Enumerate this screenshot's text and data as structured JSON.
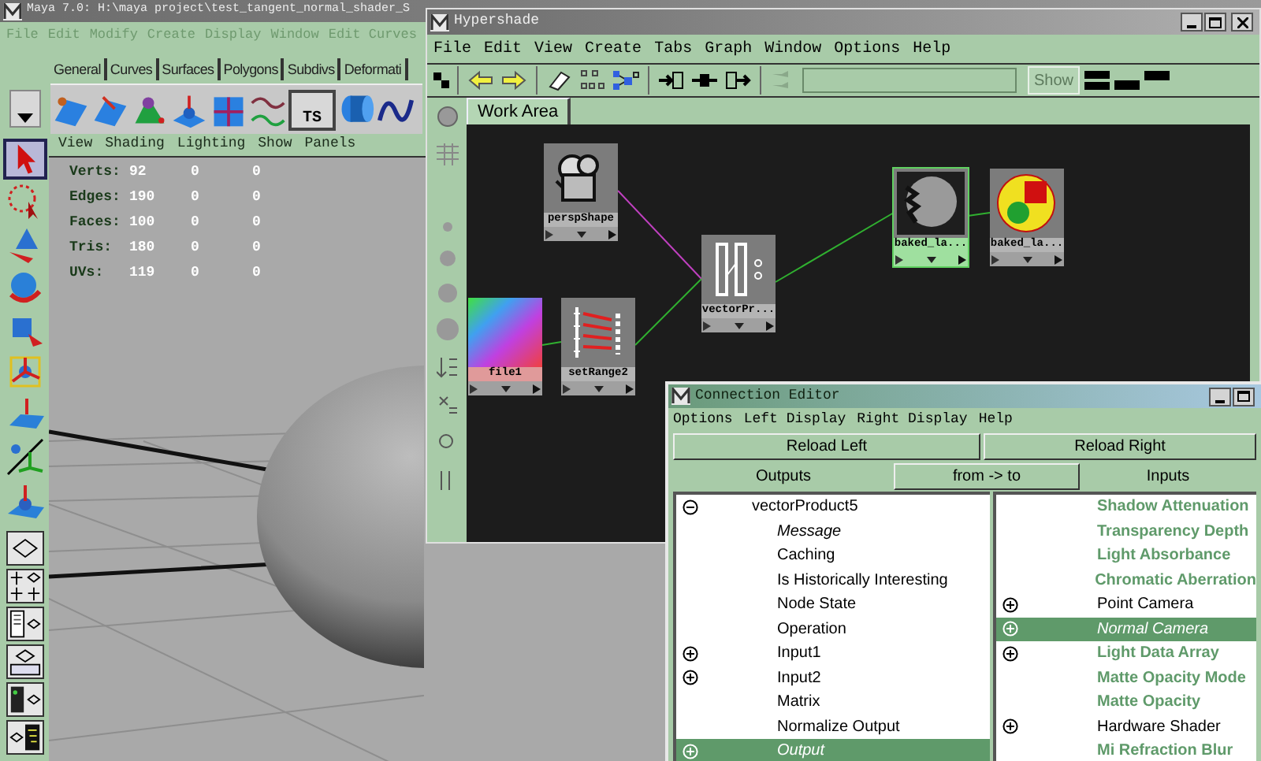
{
  "maya": {
    "title": "Maya 7.0: H:\\maya project\\test_tangent_normal_shader_S",
    "menu": [
      "File",
      "Edit",
      "Modify",
      "Create",
      "Display",
      "Window",
      "Edit Curves"
    ],
    "shelf_tabs": [
      "General",
      "Curves",
      "Surfaces",
      "Polygons",
      "Subdivs",
      "Deformati"
    ],
    "shelf_icon_label": "TS",
    "toolbox": [
      {
        "kind": "select",
        "selected": true
      },
      {
        "kind": "lasso",
        "selected": false
      },
      {
        "kind": "move",
        "selected": false
      },
      {
        "kind": "rotate",
        "selected": false
      },
      {
        "kind": "scale",
        "selected": false
      },
      {
        "kind": "manipulator",
        "selected": false
      },
      {
        "kind": "soft",
        "selected": false
      },
      {
        "kind": "axes",
        "selected": false
      },
      {
        "kind": "last",
        "selected": false
      }
    ],
    "panel_menu": [
      "View",
      "Shading",
      "Lighting",
      "Show",
      "Panels"
    ],
    "stats": [
      {
        "label": "Verts:",
        "values": [
          "92",
          "0",
          "0"
        ]
      },
      {
        "label": "Edges:",
        "values": [
          "190",
          "0",
          "0"
        ]
      },
      {
        "label": "Faces:",
        "values": [
          "100",
          "0",
          "0"
        ]
      },
      {
        "label": "Tris:",
        "values": [
          "180",
          "0",
          "0"
        ]
      },
      {
        "label": "UVs:",
        "values": [
          "119",
          "0",
          "0"
        ]
      }
    ]
  },
  "hypershade": {
    "title": "Hypershade",
    "menu": [
      "File",
      "Edit",
      "View",
      "Create",
      "Tabs",
      "Graph",
      "Window",
      "Options",
      "Help"
    ],
    "show_button": {
      "label": "Show",
      "disabled": true
    },
    "tabs": [
      {
        "label": "Work Area",
        "selected": true
      }
    ],
    "nodes": [
      {
        "label": "perspShape",
        "kind": "camera",
        "selected": false
      },
      {
        "label": "file1",
        "kind": "texture",
        "selected": false
      },
      {
        "label": "setRange2",
        "kind": "range",
        "selected": false
      },
      {
        "label": "vectorPr...",
        "kind": "vector",
        "selected": false
      },
      {
        "label": "baked_la...",
        "kind": "material",
        "selected": true
      },
      {
        "label": "baked_la...",
        "kind": "group",
        "selected": false
      }
    ]
  },
  "connection_editor": {
    "title": "Connection Editor",
    "menu": [
      "Options",
      "Left Display",
      "Right Display",
      "Help"
    ],
    "buttons": [
      "Reload Left",
      "Reload Right"
    ],
    "headers": {
      "left": "Outputs",
      "middle": "from -> to",
      "right": "Inputs"
    },
    "left_list": [
      {
        "label": "vectorProduct5",
        "kind": "compound",
        "expanded": true,
        "selected": false,
        "connected": false,
        "children": [
          {
            "label": "Message",
            "kind": "leaf",
            "selected": false,
            "connected": true
          },
          {
            "label": "Caching",
            "kind": "leaf",
            "selected": false,
            "connected": false
          },
          {
            "label": "Is Historically Interesting",
            "kind": "leaf",
            "selected": false,
            "connected": false
          },
          {
            "label": "Node State",
            "kind": "leaf",
            "selected": false,
            "connected": false
          },
          {
            "label": "Operation",
            "kind": "leaf",
            "selected": false,
            "connected": false
          },
          {
            "label": "Input1",
            "kind": "compound",
            "expanded": false,
            "selected": false,
            "connected": false
          },
          {
            "label": "Input2",
            "kind": "compound",
            "expanded": false,
            "selected": false,
            "connected": false
          },
          {
            "label": "Matrix",
            "kind": "leaf",
            "selected": false,
            "connected": false
          },
          {
            "label": "Normalize Output",
            "kind": "leaf",
            "selected": false,
            "connected": false
          },
          {
            "label": "Output",
            "kind": "compound",
            "expanded": false,
            "selected": true,
            "connected": true
          }
        ]
      }
    ],
    "right_list": [
      {
        "label": "Shadow Attenuation",
        "kind": "leaf",
        "selected": false,
        "connected": false,
        "disabled": true
      },
      {
        "label": "Transparency Depth",
        "kind": "leaf",
        "selected": false,
        "connected": false,
        "disabled": true
      },
      {
        "label": "Light Absorbance",
        "kind": "leaf",
        "selected": false,
        "connected": false,
        "disabled": true
      },
      {
        "label": "Chromatic Aberration",
        "kind": "leaf",
        "selected": false,
        "connected": false,
        "disabled": true
      },
      {
        "label": "Point Camera",
        "kind": "compound",
        "expanded": false,
        "selected": false,
        "connected": false,
        "disabled": false
      },
      {
        "label": "Normal Camera",
        "kind": "compound",
        "expanded": false,
        "selected": true,
        "connected": true,
        "disabled": false
      },
      {
        "label": "Light Data Array",
        "kind": "compound",
        "expanded": false,
        "selected": false,
        "connected": false,
        "disabled": true
      },
      {
        "label": "Matte Opacity Mode",
        "kind": "leaf",
        "selected": false,
        "connected": false,
        "disabled": true
      },
      {
        "label": "Matte Opacity",
        "kind": "leaf",
        "selected": false,
        "connected": false,
        "disabled": true
      },
      {
        "label": "Hardware Shader",
        "kind": "compound",
        "expanded": false,
        "selected": false,
        "connected": false,
        "disabled": false
      },
      {
        "label": "Mi Refraction Blur",
        "kind": "leaf",
        "selected": false,
        "connected": false,
        "disabled": true
      }
    ]
  }
}
